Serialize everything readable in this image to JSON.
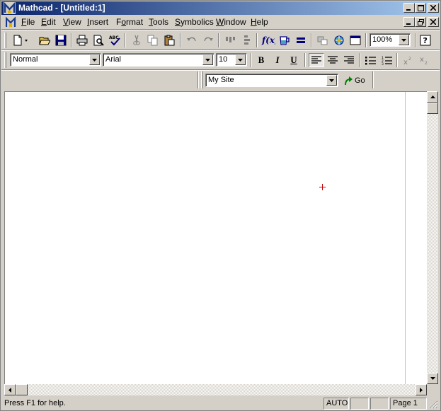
{
  "window": {
    "title": "Mathcad - [Untitled:1]"
  },
  "menu": [
    {
      "pre": "",
      "ul": "F",
      "post": "ile"
    },
    {
      "pre": "",
      "ul": "E",
      "post": "dit"
    },
    {
      "pre": "",
      "ul": "V",
      "post": "iew"
    },
    {
      "pre": "",
      "ul": "I",
      "post": "nsert"
    },
    {
      "pre": "F",
      "ul": "o",
      "post": "rmat"
    },
    {
      "pre": "",
      "ul": "T",
      "post": "ools"
    },
    {
      "pre": "",
      "ul": "S",
      "post": "ymbolics"
    },
    {
      "pre": "",
      "ul": "W",
      "post": "indow"
    },
    {
      "pre": "",
      "ul": "H",
      "post": "elp"
    }
  ],
  "standard_toolbar": {
    "zoom": "100%"
  },
  "format_toolbar": {
    "style": "Normal",
    "font": "Arial",
    "size": "10",
    "bold": "B",
    "italic": "I",
    "underline": "U"
  },
  "web_toolbar": {
    "site": "My Site",
    "go_label": "Go"
  },
  "statusbar": {
    "help": "Press F1 for help.",
    "mode": "AUTO",
    "page": "Page 1"
  },
  "colors": {
    "titlebar_start": "#0a246a",
    "titlebar_end": "#a6caf0",
    "cursor": "#c00000",
    "face": "#d4d0c8"
  }
}
